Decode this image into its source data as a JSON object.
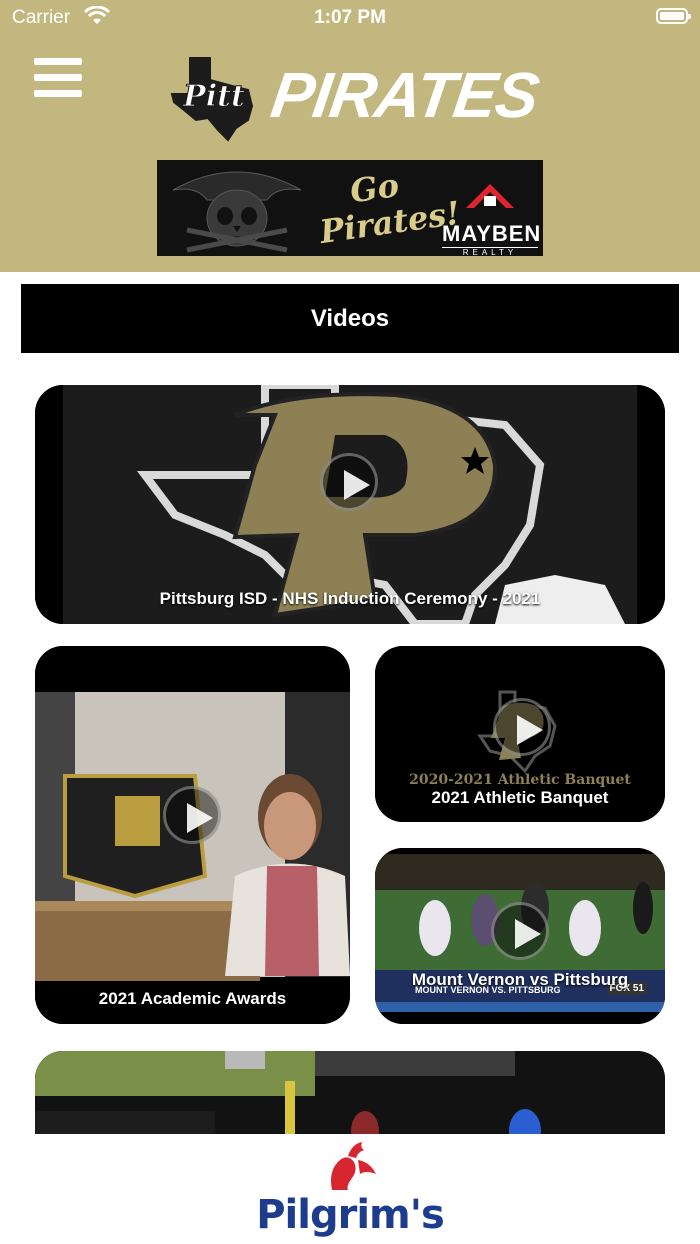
{
  "status_bar": {
    "carrier": "Carrier",
    "time": "1:07 PM"
  },
  "header": {
    "brand_text": "PIRATES",
    "logo_badge": "Pitt",
    "banner": {
      "slogan": "Go Pirates!",
      "brand_name": "MAYBEN",
      "brand_sub": "REALTY"
    }
  },
  "section": {
    "title": "Videos"
  },
  "videos": [
    {
      "title": "Pittsburg ISD - NHS Induction Ceremony - 2021"
    },
    {
      "title": "2021 Academic Awards"
    },
    {
      "title": "2021 Athletic Banquet",
      "thumb_caption": "2020-2021 Athletic Banquet"
    },
    {
      "title": "Mount Vernon vs Pittsburg",
      "scoreboard": "MOUNT VERNON VS. PITTSBURG",
      "network": "FOX 51"
    },
    {
      "title": ""
    }
  ],
  "footer": {
    "sponsor": "Pilgrim's"
  },
  "colors": {
    "header_bg": "#c2b77f",
    "accent_gold": "#8d8054",
    "sponsor_blue": "#1d3c8e",
    "sponsor_red": "#d6262f"
  }
}
